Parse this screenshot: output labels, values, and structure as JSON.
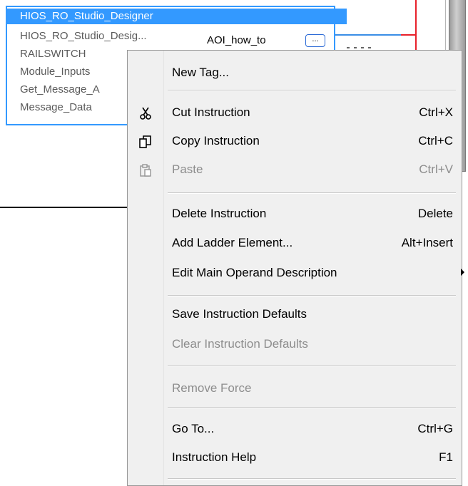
{
  "taglist": {
    "items": [
      {
        "label": "HIOS_RO_Studio_Designer",
        "selected": true
      },
      {
        "label": "HIOS_RO_Studio_Desig...",
        "selected": false
      },
      {
        "label": "RAILSWITCH",
        "selected": false
      },
      {
        "label": "Module_Inputs",
        "selected": false
      },
      {
        "label": "Get_Message_A",
        "selected": false
      },
      {
        "label": "Message_Data",
        "selected": false
      }
    ],
    "instruction_name": "AOI_how_to",
    "browse_label": "..."
  },
  "menu": {
    "items": [
      {
        "label": "New Tag...",
        "shortcut": "",
        "icon": "",
        "disabled": false
      },
      {
        "label": "Cut Instruction",
        "shortcut": "Ctrl+X",
        "icon": "scissors-icon",
        "disabled": false
      },
      {
        "label": "Copy Instruction",
        "shortcut": "Ctrl+C",
        "icon": "copy-icon",
        "disabled": false
      },
      {
        "label": "Paste",
        "shortcut": "Ctrl+V",
        "icon": "paste-icon",
        "disabled": true
      },
      {
        "label": "Delete Instruction",
        "shortcut": "Delete",
        "icon": "",
        "disabled": false
      },
      {
        "label": "Add Ladder Element...",
        "shortcut": "Alt+Insert",
        "icon": "",
        "disabled": false
      },
      {
        "label": "Edit Main Operand Description",
        "shortcut": "",
        "icon": "",
        "disabled": false,
        "submenu": true
      },
      {
        "label": "Save Instruction Defaults",
        "shortcut": "",
        "icon": "",
        "disabled": false
      },
      {
        "label": "Clear Instruction Defaults",
        "shortcut": "",
        "icon": "",
        "disabled": true
      },
      {
        "label": "Remove Force",
        "shortcut": "",
        "icon": "",
        "disabled": true
      },
      {
        "label": "Go To...",
        "shortcut": "Ctrl+G",
        "icon": "",
        "disabled": false
      },
      {
        "label": "Instruction Help",
        "shortcut": "F1",
        "icon": "",
        "disabled": false
      }
    ]
  },
  "colors": {
    "selection": "#3399ff",
    "rail_red": "#e8202a",
    "wire_blue": "#3a8ee6",
    "menu_bg": "#f0f0f0",
    "disabled_text": "#8d8d8d"
  }
}
